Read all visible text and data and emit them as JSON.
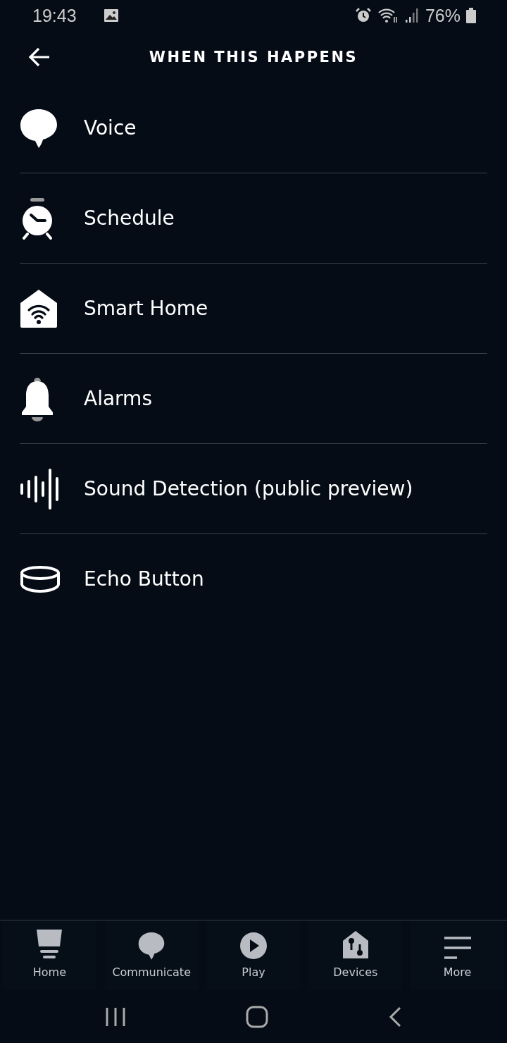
{
  "status_bar": {
    "time": "19:43",
    "battery": "76%"
  },
  "header": {
    "title": "WHEN THIS HAPPENS"
  },
  "triggers": [
    {
      "kind": "voice",
      "label": "Voice"
    },
    {
      "kind": "schedule",
      "label": "Schedule"
    },
    {
      "kind": "smarthome",
      "label": "Smart Home"
    },
    {
      "kind": "alarm",
      "label": "Alarms"
    },
    {
      "kind": "sound",
      "label": "Sound Detection (public preview)"
    },
    {
      "kind": "button",
      "label": "Echo Button"
    }
  ],
  "bottom_nav": [
    {
      "kind": "home",
      "label": "Home"
    },
    {
      "kind": "communicate",
      "label": "Communicate"
    },
    {
      "kind": "play",
      "label": "Play"
    },
    {
      "kind": "devices",
      "label": "Devices"
    },
    {
      "kind": "more",
      "label": "More"
    }
  ]
}
